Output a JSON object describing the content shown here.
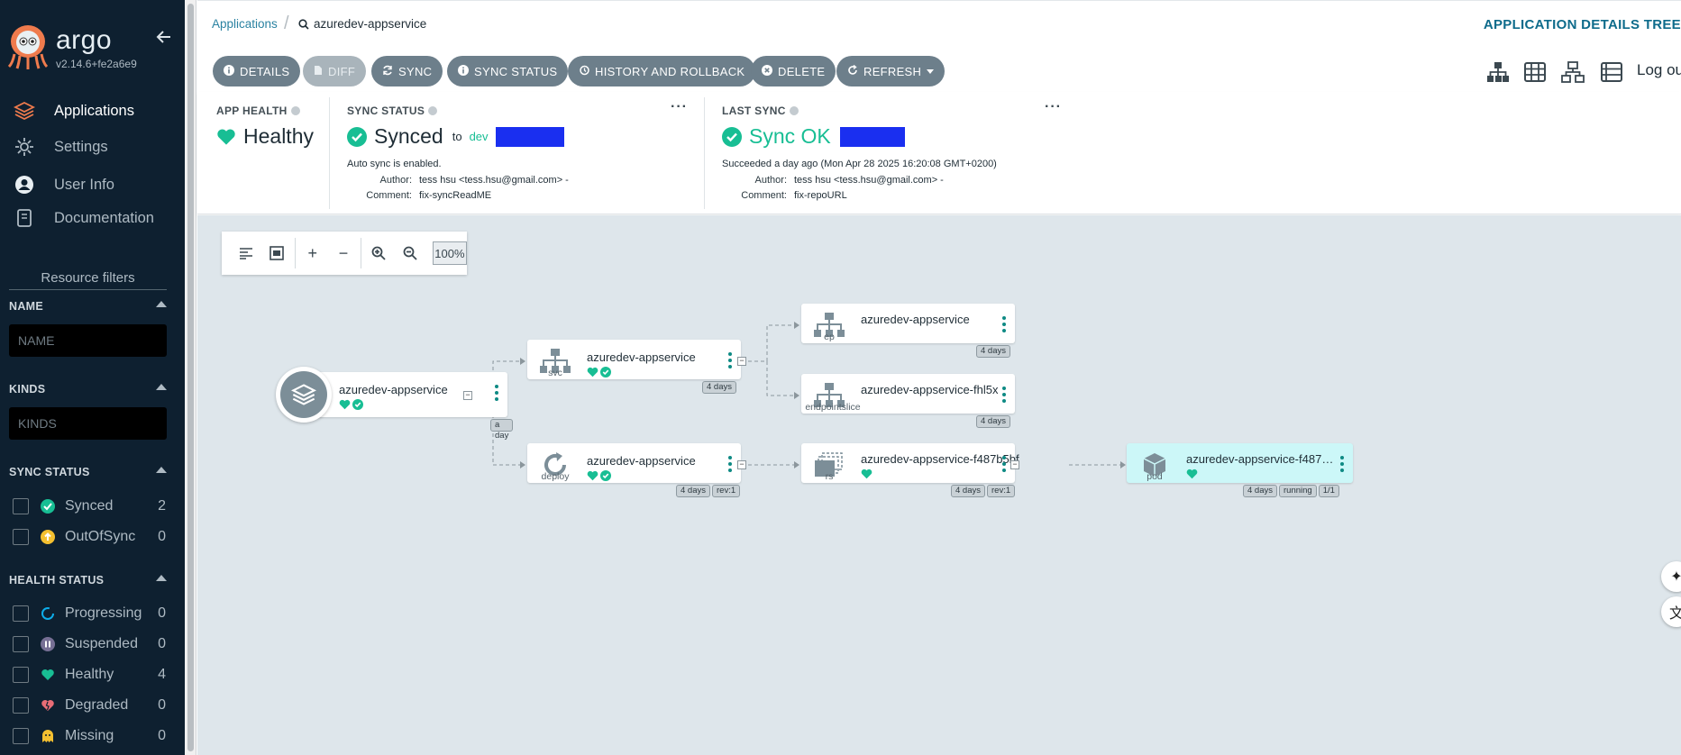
{
  "brand": {
    "name": "argo",
    "version": "v2.14.6+fe2a6e9"
  },
  "nav": [
    {
      "label": "Applications",
      "icon": "layers-icon"
    },
    {
      "label": "Settings",
      "icon": "gear-icon"
    },
    {
      "label": "User Info",
      "icon": "user-icon"
    },
    {
      "label": "Documentation",
      "icon": "book-icon"
    }
  ],
  "filters": {
    "title": "Resource filters",
    "name": {
      "label": "NAME",
      "placeholder": "NAME"
    },
    "kinds": {
      "label": "KINDS",
      "placeholder": "KINDS"
    },
    "sync_status": {
      "label": "SYNC STATUS",
      "items": [
        {
          "label": "Synced",
          "count": "2",
          "icon": "synced-icon"
        },
        {
          "label": "OutOfSync",
          "count": "0",
          "icon": "out-of-sync-icon"
        }
      ]
    },
    "health_status": {
      "label": "HEALTH STATUS",
      "items": [
        {
          "label": "Progressing",
          "count": "0",
          "icon": "progressing-icon"
        },
        {
          "label": "Suspended",
          "count": "0",
          "icon": "suspended-icon"
        },
        {
          "label": "Healthy",
          "count": "4",
          "icon": "heart-icon"
        },
        {
          "label": "Degraded",
          "count": "0",
          "icon": "broken-heart-icon"
        },
        {
          "label": "Missing",
          "count": "0",
          "icon": "ghost-icon"
        }
      ]
    }
  },
  "breadcrumb": {
    "root": "Applications",
    "current": "azuredev-appservice"
  },
  "page_title": "APPLICATION DETAILS TREE",
  "toolbar": {
    "details": "DETAILS",
    "diff": "DIFF",
    "sync": "SYNC",
    "sync_status": "SYNC STATUS",
    "history": "HISTORY AND ROLLBACK",
    "delete": "DELETE",
    "refresh": "REFRESH",
    "logout": "Log out"
  },
  "app_health": {
    "label": "APP HEALTH",
    "value": "Healthy"
  },
  "sync_status": {
    "label": "SYNC STATUS",
    "value": "Synced",
    "to": "to",
    "target": "dev",
    "auto": "Auto sync is enabled.",
    "author_label": "Author:",
    "author": "tess hsu <tess.hsu@gmail.com> -",
    "comment_label": "Comment:",
    "comment": "fix-syncReadME"
  },
  "last_sync": {
    "label": "LAST SYNC",
    "value": "Sync OK",
    "succeeded": "Succeeded a day ago (Mon Apr 28 2025 16:20:08 GMT+0200)",
    "author_label": "Author:",
    "author": "tess hsu <tess.hsu@gmail.com> -",
    "comment_label": "Comment:",
    "comment": "fix-repoURL"
  },
  "zoom": {
    "value": "100%"
  },
  "graph": {
    "app": {
      "name": "azuredev-appservice",
      "tag": "a day"
    },
    "svc": {
      "name": "azuredev-appservice",
      "kind": "svc",
      "tags": [
        "4 days"
      ]
    },
    "deploy": {
      "name": "azuredev-appservice",
      "kind": "deploy",
      "tags": [
        "4 days",
        "rev:1"
      ]
    },
    "ep": {
      "name": "azuredev-appservice",
      "kind": "ep",
      "tags": [
        "4 days"
      ]
    },
    "endpointslice": {
      "name": "azuredev-appservice-fhl5x",
      "kind": "endpointslice",
      "tags": [
        "4 days"
      ]
    },
    "rs": {
      "name": "azuredev-appservice-f487b5bf",
      "kind": "rs",
      "tags": [
        "4 days",
        "rev:1"
      ]
    },
    "pod": {
      "name": "azuredev-appservice-f487b5b...",
      "kind": "pod",
      "tags": [
        "4 days",
        "running",
        "1/1"
      ]
    }
  },
  "colors": {
    "sidebar": "#0e2030",
    "healthy": "#18be94",
    "accent": "#0e6b8b",
    "canvas": "#dee6eb",
    "pod": "#ccf7f8"
  }
}
